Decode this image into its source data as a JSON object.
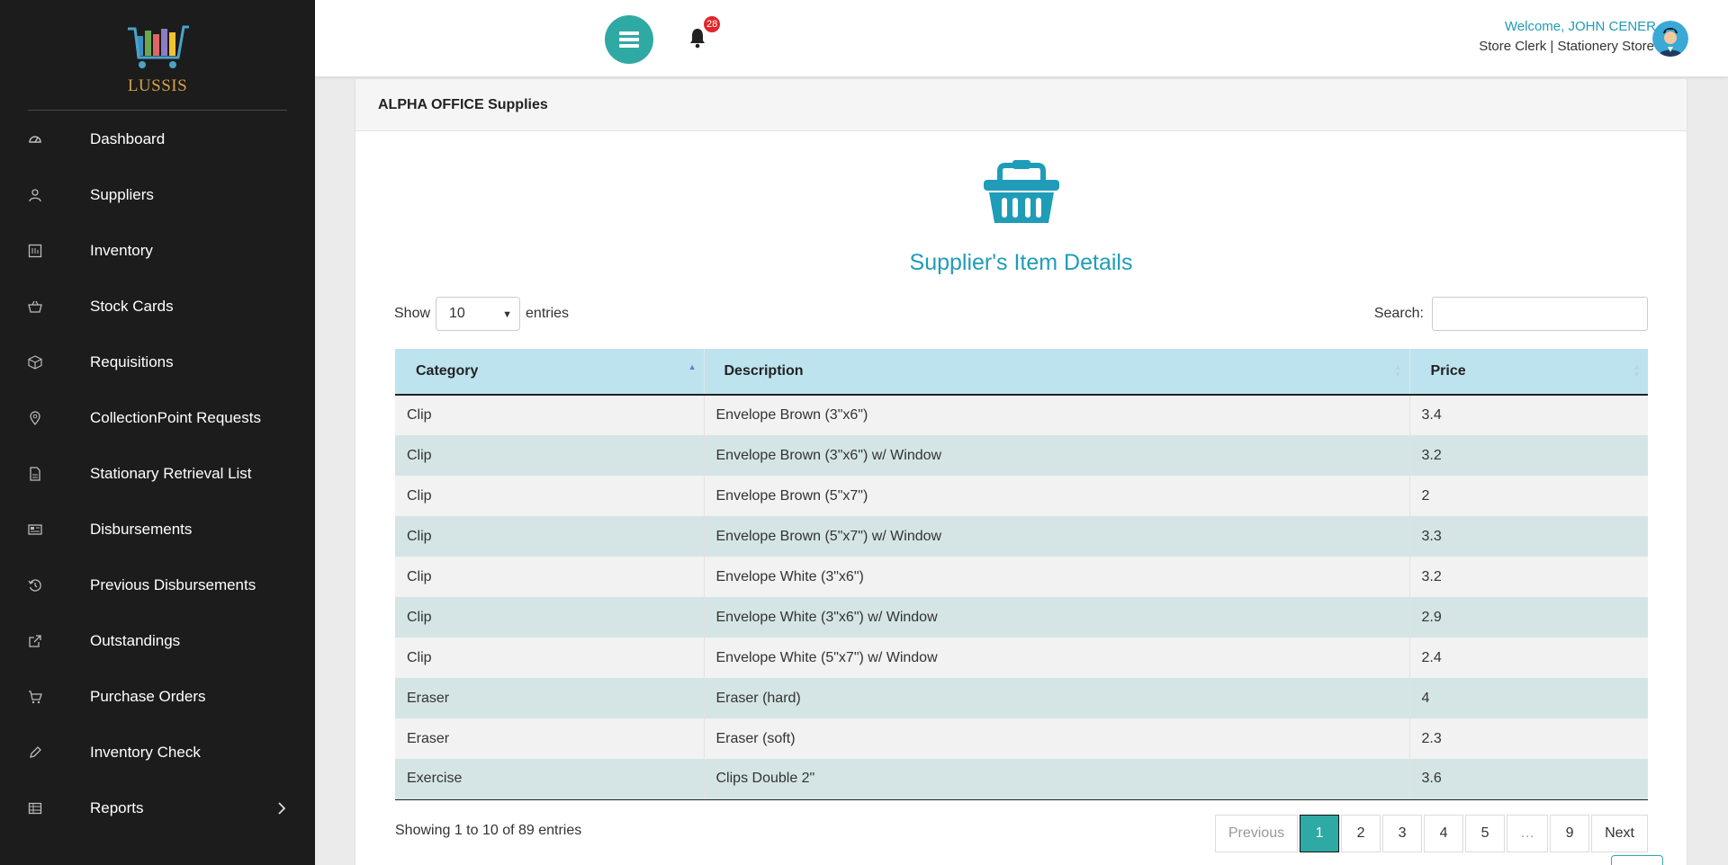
{
  "app": {
    "logo_text": "LUSSIS"
  },
  "sidebar": {
    "items": [
      {
        "label": "Dashboard",
        "icon": "dashboard-icon"
      },
      {
        "label": "Suppliers",
        "icon": "user-icon"
      },
      {
        "label": "Inventory",
        "icon": "inventory-icon"
      },
      {
        "label": "Stock Cards",
        "icon": "basket-icon"
      },
      {
        "label": "Requisitions",
        "icon": "box-icon"
      },
      {
        "label": "CollectionPoint Requests",
        "icon": "map-pin-icon"
      },
      {
        "label": "Stationary Retrieval List",
        "icon": "document-icon"
      },
      {
        "label": "Disbursements",
        "icon": "newspaper-icon"
      },
      {
        "label": "Previous Disbursements",
        "icon": "history-icon"
      },
      {
        "label": "Outstandings",
        "icon": "external-link-icon"
      },
      {
        "label": "Purchase Orders",
        "icon": "cart-icon"
      },
      {
        "label": "Inventory Check",
        "icon": "pencil-icon"
      },
      {
        "label": "Reports",
        "icon": "table-icon"
      }
    ]
  },
  "header": {
    "notification_count": "28",
    "welcome": "Welcome, JOHN CENER",
    "role": "Store Clerk | Stationery Store"
  },
  "panel": {
    "heading": "ALPHA OFFICE Supplies",
    "title": "Supplier's Item Details"
  },
  "table_controls": {
    "show_label": "Show",
    "entries_value": "10",
    "entries_label": "entries",
    "search_label": "Search:"
  },
  "table": {
    "columns": [
      "Category",
      "Description",
      "Price"
    ],
    "rows": [
      [
        "Clip",
        "Envelope Brown (3\"x6\")",
        "3.4"
      ],
      [
        "Clip",
        "Envelope Brown (3\"x6\") w/ Window",
        "3.2"
      ],
      [
        "Clip",
        "Envelope Brown (5\"x7\")",
        "2"
      ],
      [
        "Clip",
        "Envelope Brown (5\"x7\") w/ Window",
        "3.3"
      ],
      [
        "Clip",
        "Envelope White (3\"x6\")",
        "3.2"
      ],
      [
        "Clip",
        "Envelope White (3\"x6\") w/ Window",
        "2.9"
      ],
      [
        "Clip",
        "Envelope White (5\"x7\") w/ Window",
        "2.4"
      ],
      [
        "Eraser",
        "Eraser (hard)",
        "4"
      ],
      [
        "Eraser",
        "Eraser (soft)",
        "2.3"
      ],
      [
        "Exercise",
        "Clips Double 2\"",
        "3.6"
      ]
    ]
  },
  "footer": {
    "info": "Showing 1 to 10 of 89 entries",
    "previous": "Previous",
    "pages": [
      "1",
      "2",
      "3",
      "4",
      "5",
      "…",
      "9"
    ],
    "next": "Next"
  },
  "colors": {
    "accent": "#2fa9a4",
    "title": "#1f9cb8",
    "sidebar_bg": "#1c1c1c",
    "table_header": "#bde3ee"
  }
}
